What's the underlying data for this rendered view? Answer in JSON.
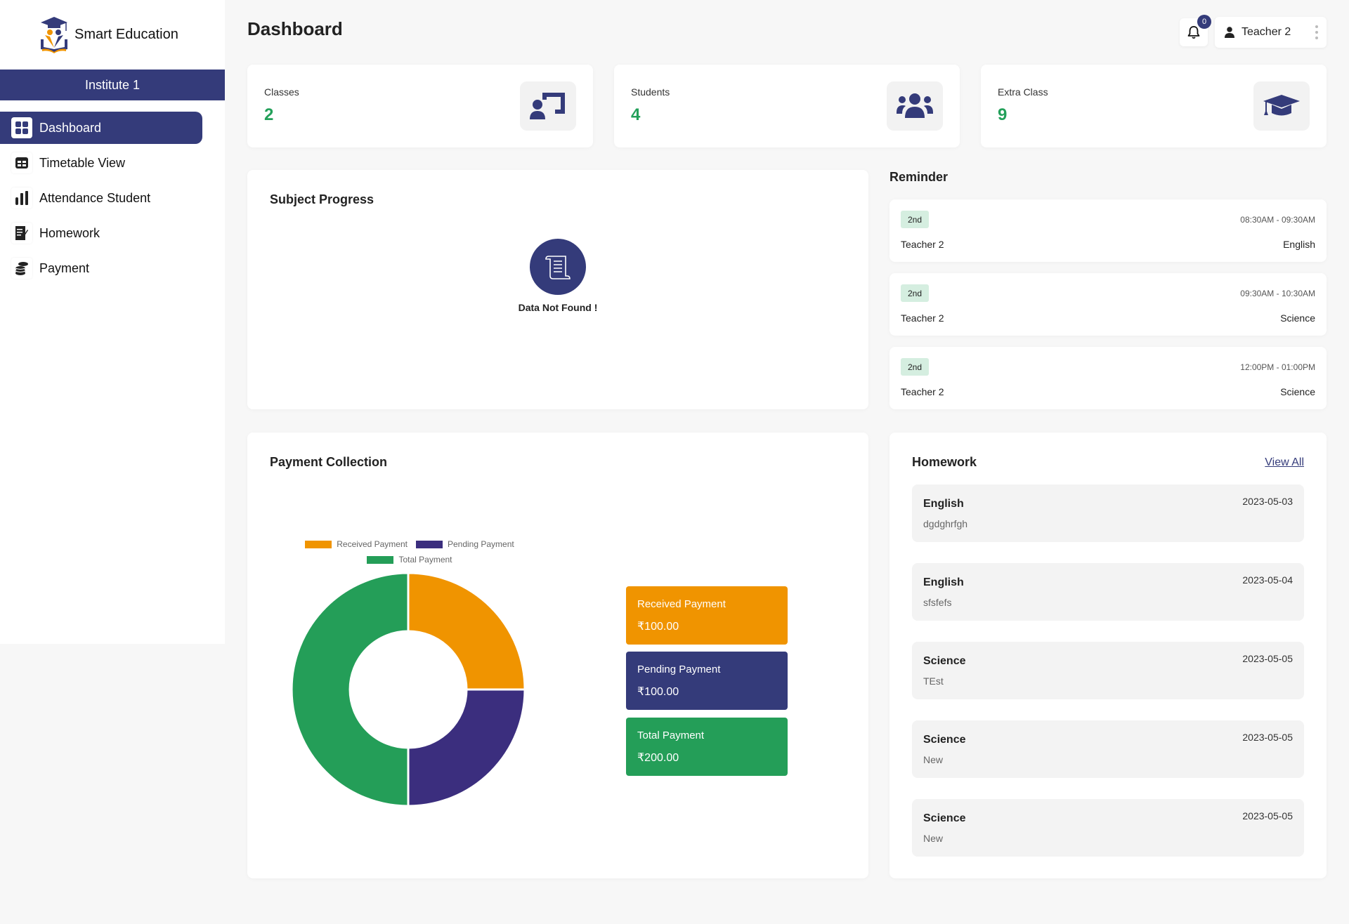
{
  "brand": {
    "name": "Smart Education"
  },
  "institute": "Institute 1",
  "sidebar": {
    "items": [
      {
        "label": "Dashboard",
        "icon": "grid-icon",
        "active": true
      },
      {
        "label": "Timetable View",
        "icon": "table-icon",
        "active": false
      },
      {
        "label": "Attendance Student",
        "icon": "bar-chart-icon",
        "active": false
      },
      {
        "label": "Homework",
        "icon": "document-edit-icon",
        "active": false
      },
      {
        "label": "Payment",
        "icon": "coins-icon",
        "active": false
      }
    ]
  },
  "header": {
    "title": "Dashboard",
    "notification_count": "0",
    "user_name": "Teacher 2"
  },
  "stats": [
    {
      "label": "Classes",
      "value": "2",
      "icon": "teacher-board-icon"
    },
    {
      "label": "Students",
      "value": "4",
      "icon": "users-icon"
    },
    {
      "label": "Extra Class",
      "value": "9",
      "icon": "graduation-cap-icon"
    }
  ],
  "subject_progress": {
    "title": "Subject Progress",
    "empty_text": "Data Not Found !"
  },
  "reminder": {
    "title": "Reminder",
    "items": [
      {
        "badge": "2nd",
        "time": "08:30AM - 09:30AM",
        "teacher": "Teacher 2",
        "subject": "English"
      },
      {
        "badge": "2nd",
        "time": "09:30AM - 10:30AM",
        "teacher": "Teacher 2",
        "subject": "Science"
      },
      {
        "badge": "2nd",
        "time": "12:00PM - 01:00PM",
        "teacher": "Teacher 2",
        "subject": "Science"
      }
    ]
  },
  "payment": {
    "title": "Payment Collection",
    "cards": [
      {
        "label": "Received Payment",
        "amount": "₹100.00",
        "color": "#f09400"
      },
      {
        "label": "Pending Payment",
        "amount": "₹100.00",
        "color": "#343b7a"
      },
      {
        "label": "Total Payment",
        "amount": "₹200.00",
        "color": "#249e58"
      }
    ]
  },
  "chart_data": {
    "type": "pie",
    "variant": "doughnut",
    "title": "",
    "categories": [
      "Received Payment",
      "Pending Payment",
      "Total Payment"
    ],
    "values": [
      100,
      100,
      200
    ],
    "colors": [
      "#f09400",
      "#3b2e7e",
      "#249e58"
    ],
    "legend": "top-center"
  },
  "homework": {
    "title": "Homework",
    "view_all": "View All",
    "items": [
      {
        "subject": "English",
        "desc": "dgdghrfgh",
        "date": "2023-05-03"
      },
      {
        "subject": "English",
        "desc": "sfsfefs",
        "date": "2023-05-04"
      },
      {
        "subject": "Science",
        "desc": "TEst",
        "date": "2023-05-05"
      },
      {
        "subject": "Science",
        "desc": "New",
        "date": "2023-05-05"
      },
      {
        "subject": "Science",
        "desc": "New",
        "date": "2023-05-05"
      }
    ]
  }
}
